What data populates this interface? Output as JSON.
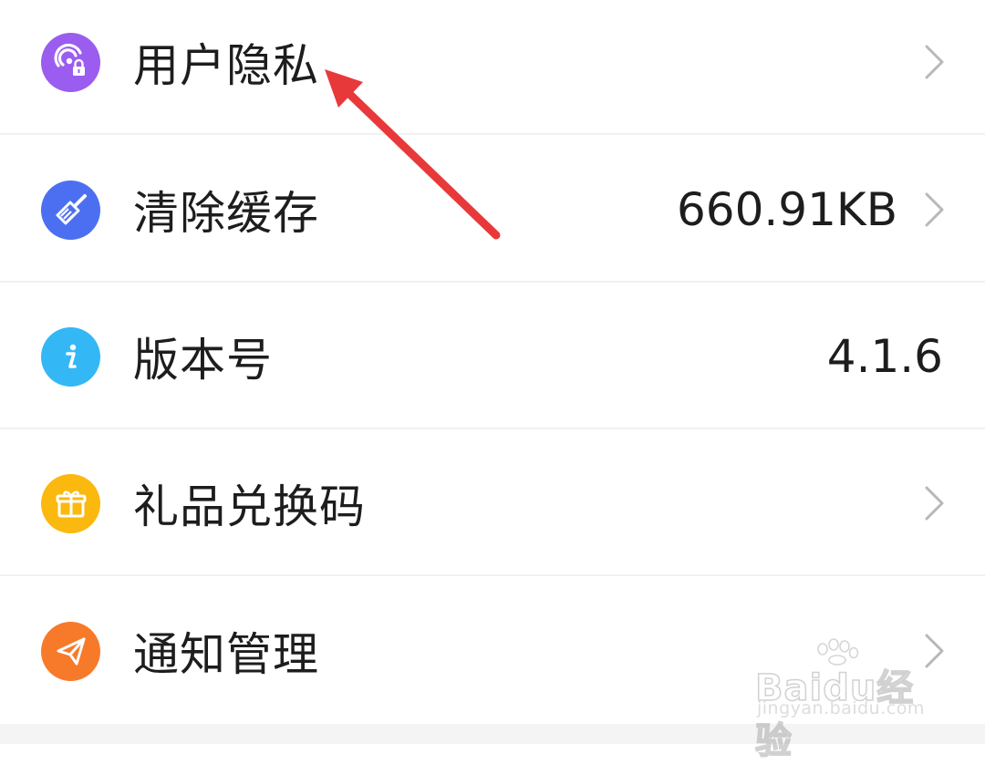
{
  "settings": {
    "items": [
      {
        "label": "用户隐私",
        "value": "",
        "icon": "privacy-lock-icon",
        "icon_color": "#9b5cf0",
        "has_chevron": true
      },
      {
        "label": "清除缓存",
        "value": "660.91KB",
        "icon": "broom-icon",
        "icon_color": "#4c6ff2",
        "has_chevron": true
      },
      {
        "label": "版本号",
        "value": "4.1.6",
        "icon": "info-icon",
        "icon_color": "#33b8f5",
        "has_chevron": false
      },
      {
        "label": "礼品兑换码",
        "value": "",
        "icon": "gift-icon",
        "icon_color": "#fbb80f",
        "has_chevron": true
      },
      {
        "label": "通知管理",
        "value": "",
        "icon": "paper-plane-icon",
        "icon_color": "#f77a2b",
        "has_chevron": true
      }
    ]
  },
  "annotation": {
    "color": "#e8393a",
    "target": "用户隐私"
  },
  "watermark": {
    "logo": "Baidu经验",
    "url": "jingyan.baidu.com"
  },
  "colors": {
    "text": "#1d1d1d",
    "chevron": "#b8b8b8",
    "divider": "#f1f1f1",
    "background": "#ffffff"
  }
}
